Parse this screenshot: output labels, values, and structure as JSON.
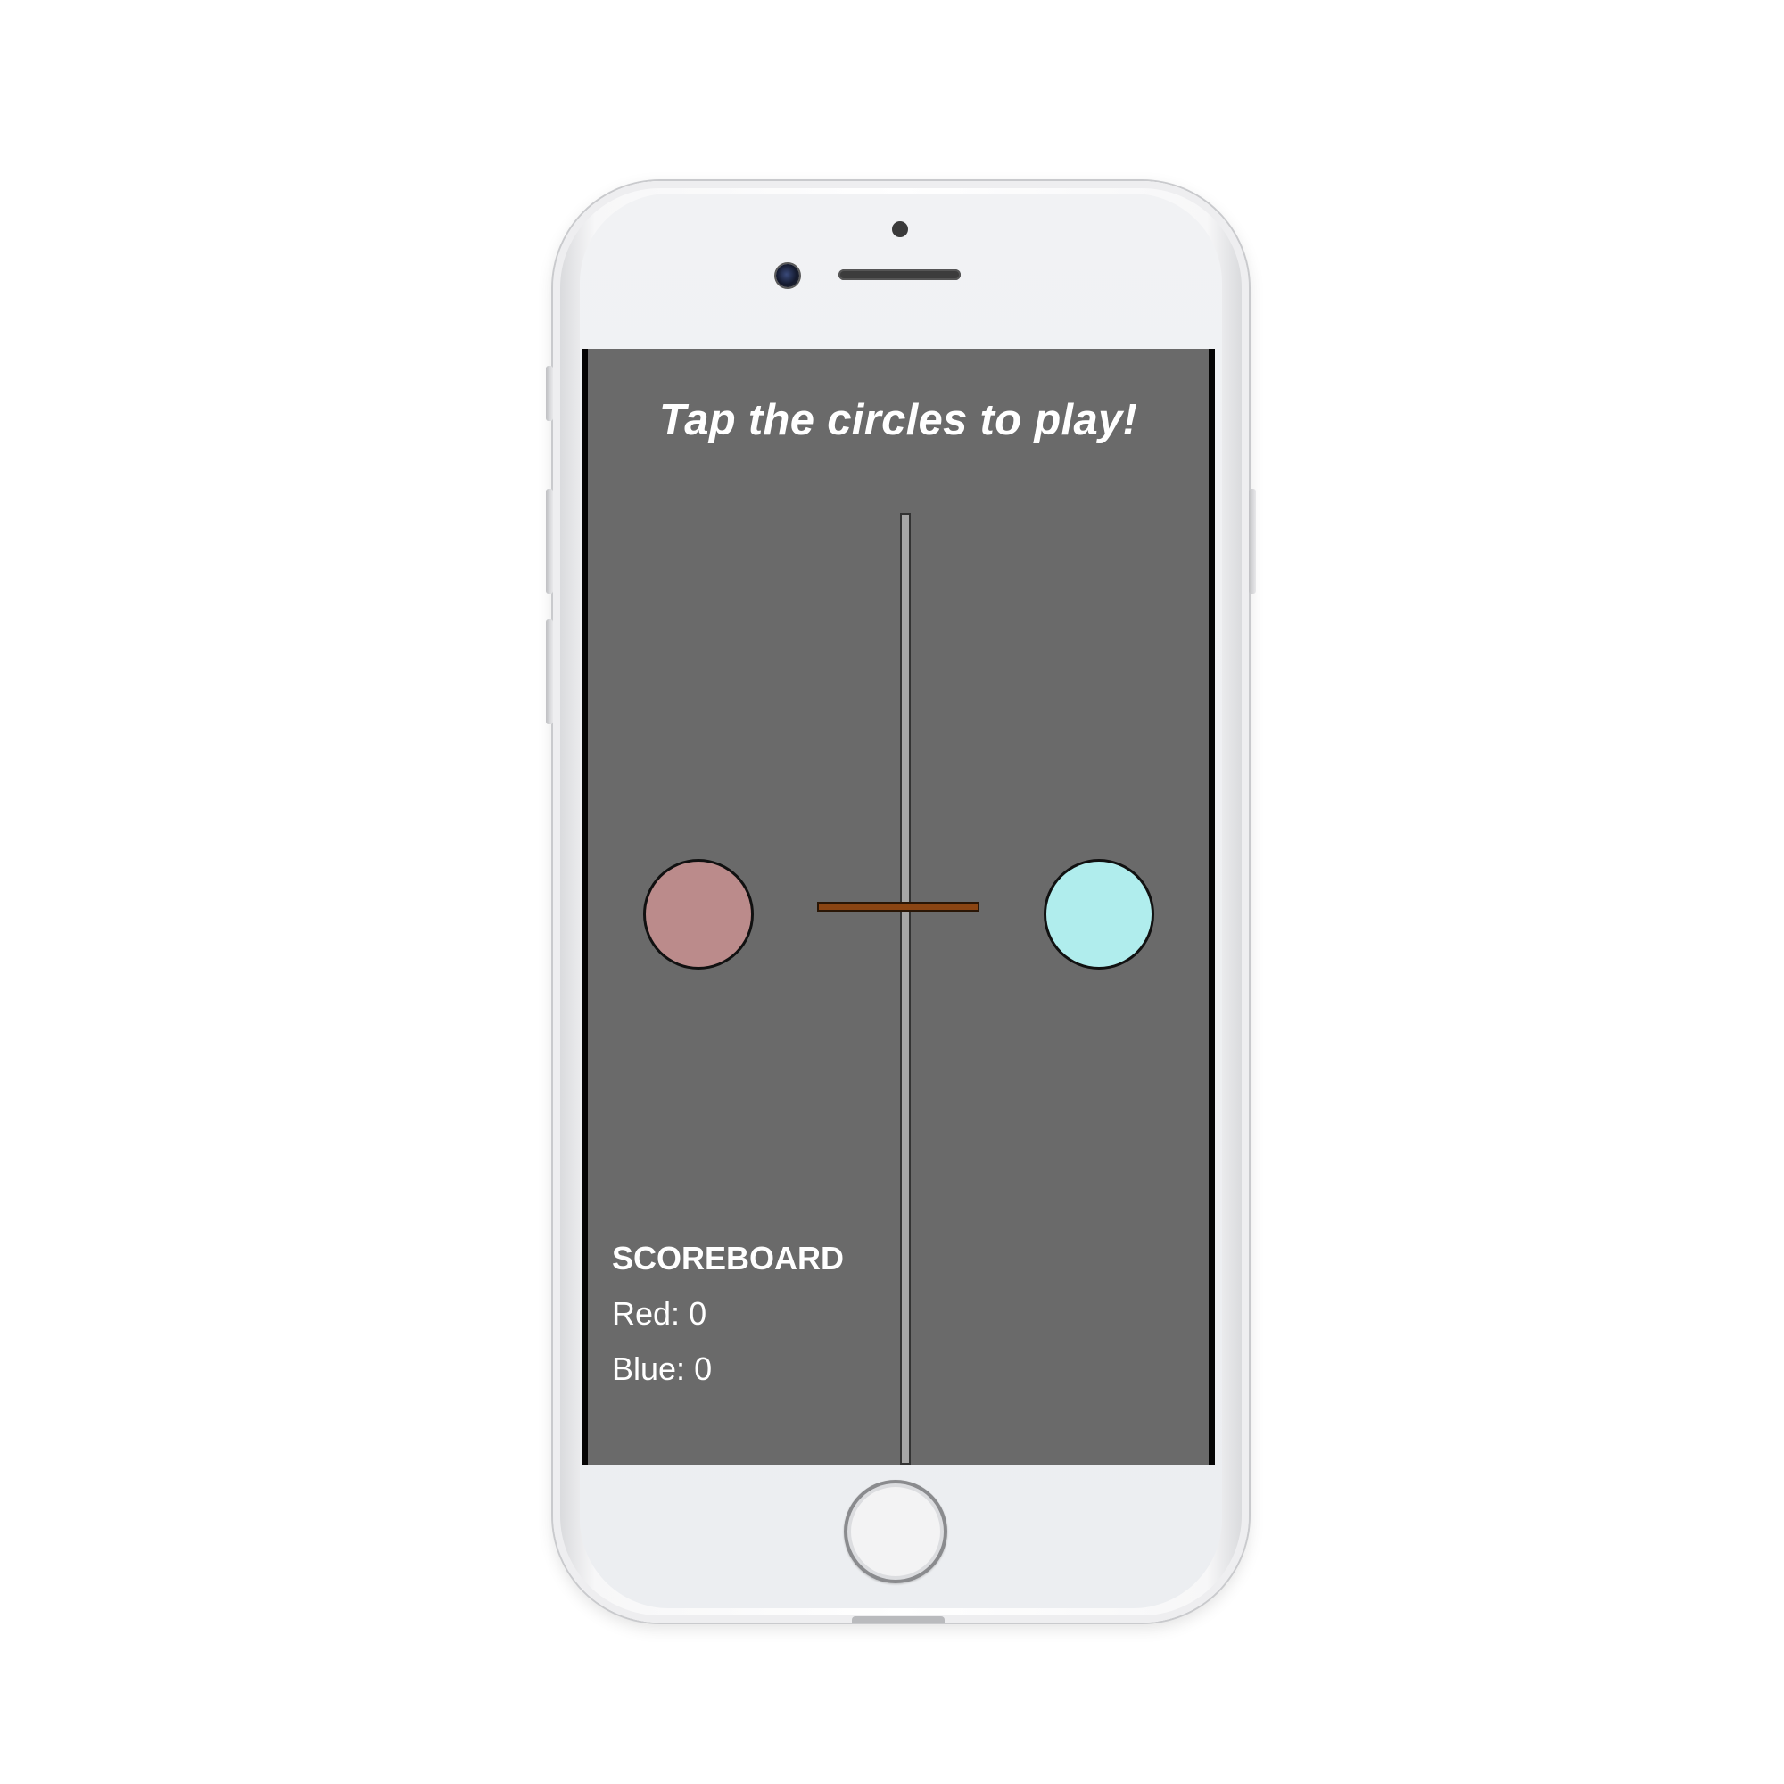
{
  "game": {
    "title": "Tap the circles to play!",
    "scoreboard": {
      "heading": "SCOREBOARD",
      "red_label": "Red:",
      "red_score": "0",
      "blue_label": "Blue:",
      "blue_score": "0"
    }
  },
  "colors": {
    "screen_background": "#6a6a6a",
    "red_circle": "#bb8b8b",
    "blue_circle": "#b0eded",
    "paddle": "#8b4513",
    "divider": "#a6a6a6",
    "text": "#ffffff"
  },
  "icons": {
    "front_camera": "camera-icon",
    "speaker": "speaker-icon",
    "home_button": "home-button-icon"
  }
}
